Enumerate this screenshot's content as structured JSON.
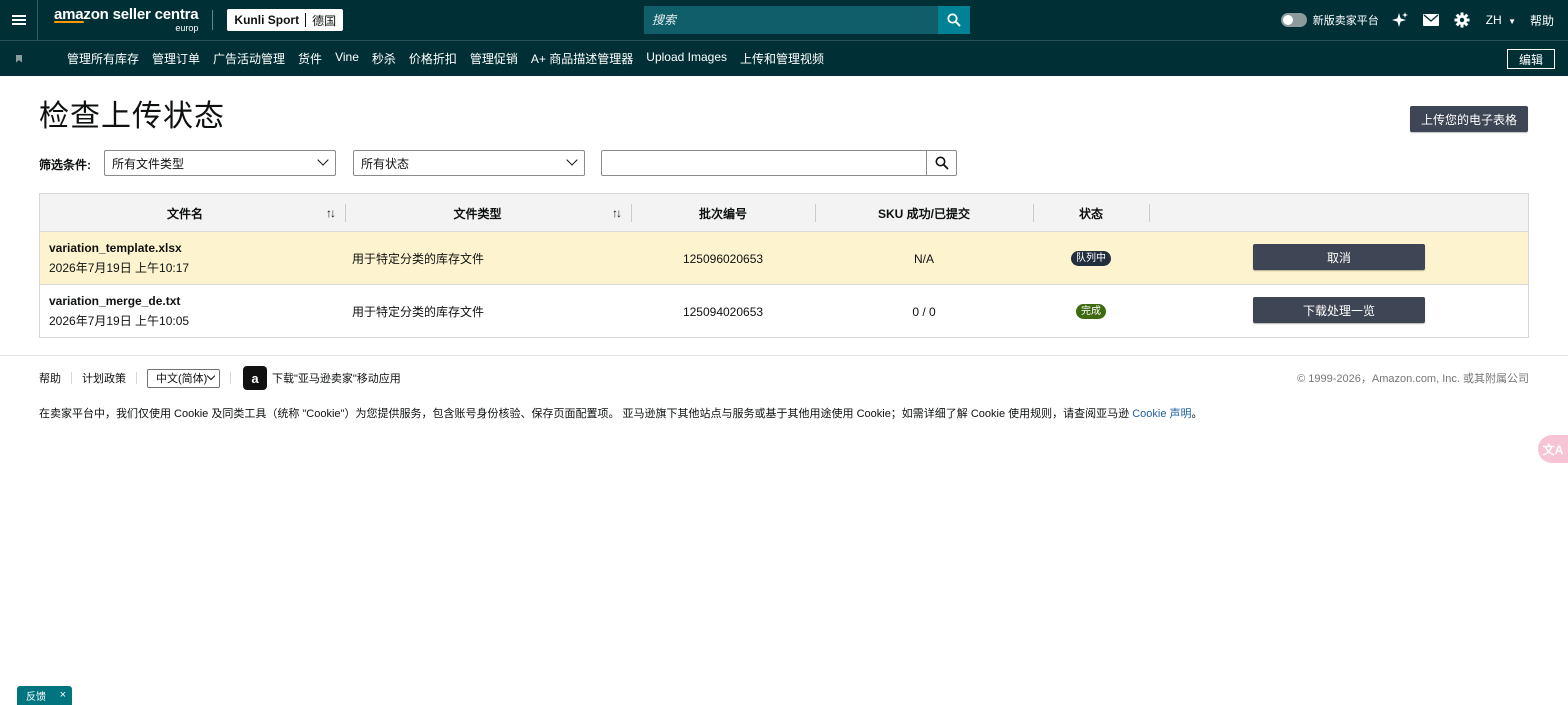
{
  "topbar": {
    "logo_main": "amazon seller centra",
    "logo_sub": "europ",
    "store_name": "Kunli Sport",
    "store_region": "德国",
    "search_placeholder": "搜索",
    "new_platform_label": "新版卖家平台",
    "lang": "ZH",
    "help": "帮助"
  },
  "nav": {
    "items": [
      "管理所有库存",
      "管理订单",
      "广告活动管理",
      "货件",
      "Vine",
      "秒杀",
      "价格折扣",
      "管理促销",
      "A+ 商品描述管理器",
      "Upload Images",
      "上传和管理视频"
    ],
    "edit": "编辑"
  },
  "page": {
    "title": "检查上传状态",
    "upload_button": "上传您的电子表格",
    "filter_label": "筛选条件:",
    "file_type_select": "所有文件类型",
    "status_select": "所有状态",
    "search_value": ""
  },
  "table": {
    "headers": [
      "文件名",
      "文件类型",
      "批次编号",
      "SKU 成功/已提交",
      "状态"
    ],
    "rows": [
      {
        "filename": "variation_template.xlsx",
        "datetime": "2026年7月19日 上午10:17",
        "filetype": "用于特定分类的库存文件",
        "batch": "125096020653",
        "sku": "N/A",
        "status": "队列中",
        "action": "取消"
      },
      {
        "filename": "variation_merge_de.txt",
        "datetime": "2026年7月19日 上午10:05",
        "filetype": "用于特定分类的库存文件",
        "batch": "125094020653",
        "sku": "0 / 0",
        "status": "完成",
        "action": "下载处理一览"
      }
    ]
  },
  "footer": {
    "help": "帮助",
    "policy": "计划政策",
    "language": "中文(简体)",
    "app_download": "下载\"亚马逊卖家\"移动应用",
    "copyright": "© 1999-2026，Amazon.com, Inc. 或其附属公司",
    "cookie_text": "在卖家平台中，我们仅使用 Cookie 及同类工具（统称 \"Cookie\"）为您提供服务，包含账号身份核验、保存页面配置项。 亚马逊旗下其他站点与服务或基于其他用途使用 Cookie；如需详细了解 Cookie 使用规则，请查阅亚马逊 ",
    "cookie_link": "Cookie 声明",
    "cookie_end": "。"
  },
  "widgets": {
    "feedback": "反馈",
    "feedback_close": "×"
  },
  "colors": {
    "header_bg": "#002f36",
    "search_bg": "#0f5e69",
    "search_btn": "#008296",
    "button_dark": "#3e4554",
    "row_highlight": "#fdf4cf",
    "badge_queue": "#232f3e",
    "badge_done": "#3e6a12"
  }
}
